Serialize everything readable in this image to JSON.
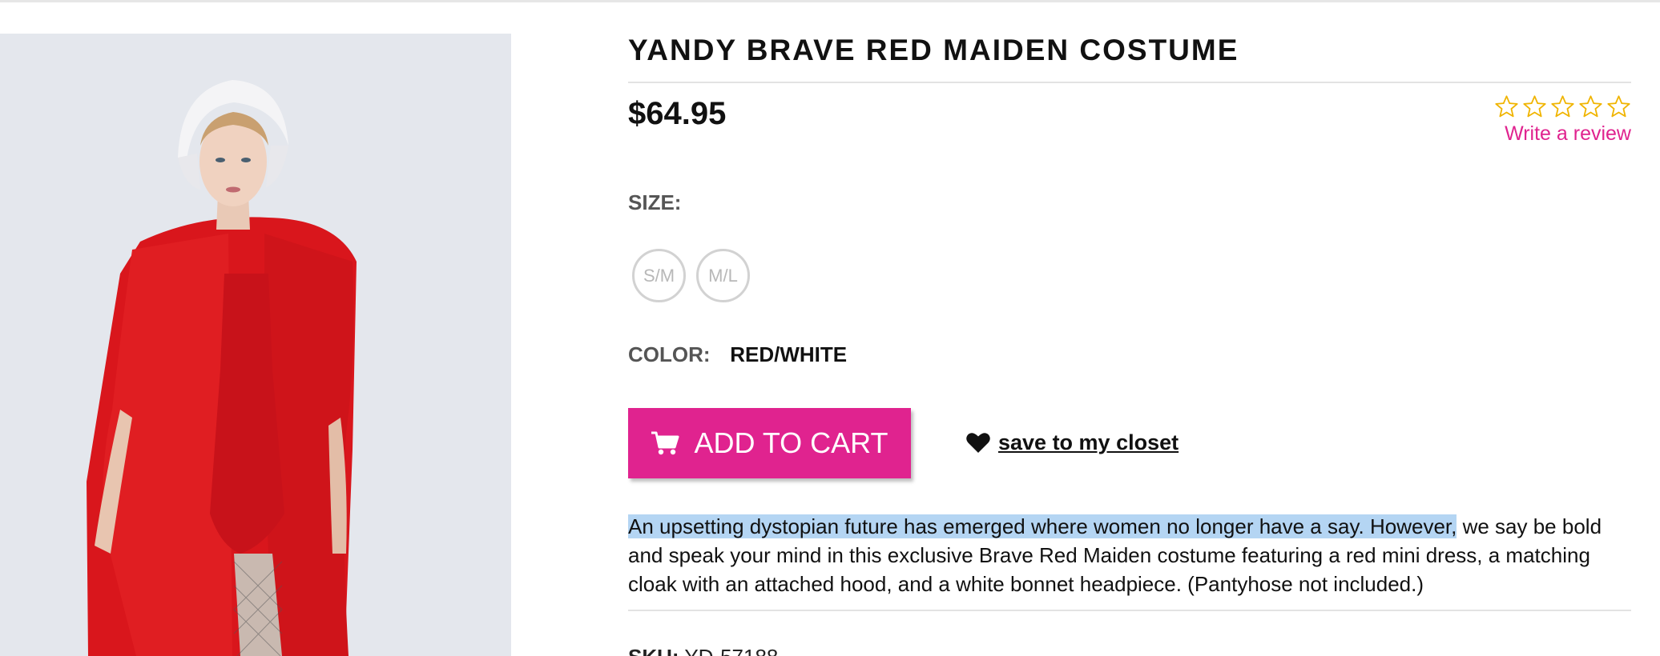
{
  "product": {
    "title": "YANDY BRAVE RED MAIDEN COSTUME",
    "price": "$64.95",
    "rating_stars": 5,
    "rating_filled": 0,
    "write_review_label": "Write a review",
    "size_label": "SIZE:",
    "sizes": [
      "S/M",
      "M/L"
    ],
    "color_label": "COLOR:",
    "color_value": "RED/WHITE",
    "add_to_cart_label": "ADD TO CART",
    "save_label": " save to my closet",
    "description_highlighted": "An upsetting dystopian future has emerged where women no longer have a say. However,",
    "description_rest": " we say be bold and speak your mind in this exclusive Brave Red Maiden costume featuring a red mini dress, a matching cloak with an attached hood, and a white bonnet headpiece. (Pantyhose not included.)",
    "sku_label": "SKU:",
    "sku_value": " YD-57188"
  },
  "icons": {
    "cart": "shopping-cart-icon",
    "heart": "heart-icon",
    "star": "star-outline-icon"
  },
  "colors": {
    "accent": "#e0238f",
    "star": "#f0b400",
    "highlight": "#b4d5f3"
  }
}
